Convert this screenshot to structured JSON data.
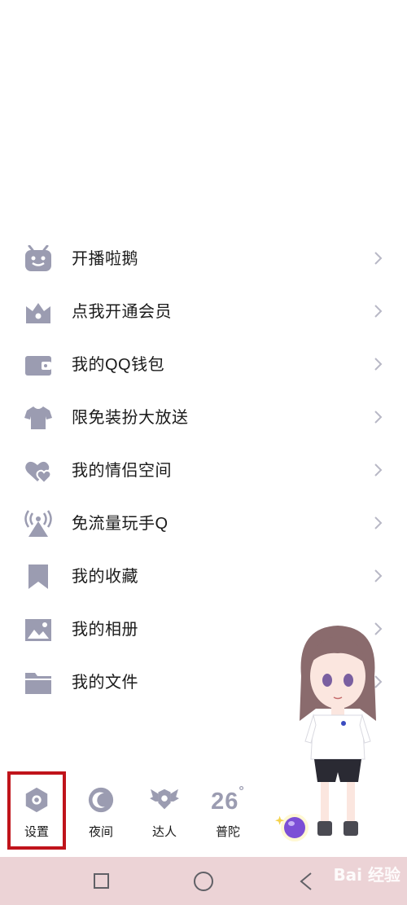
{
  "menu": {
    "items": [
      {
        "label": "开播啦鹅",
        "icon": "robot-tv-icon"
      },
      {
        "label": "点我开通会员",
        "icon": "crown-icon"
      },
      {
        "label": "我的QQ钱包",
        "icon": "wallet-icon"
      },
      {
        "label": "限免装扮大放送",
        "icon": "tshirt-icon"
      },
      {
        "label": "我的情侣空间",
        "icon": "couple-heart-icon"
      },
      {
        "label": "免流量玩手Q",
        "icon": "signal-tower-icon"
      },
      {
        "label": "我的收藏",
        "icon": "bookmark-icon"
      },
      {
        "label": "我的相册",
        "icon": "photo-icon"
      },
      {
        "label": "我的文件",
        "icon": "folder-icon"
      }
    ]
  },
  "toolbar": {
    "settings_label": "设置",
    "night_label": "夜间",
    "expert_label": "达人",
    "weather_temp": "26",
    "weather_degree": "°",
    "weather_city": "普陀"
  },
  "watermark": "Bai 经验",
  "colors": {
    "icon": "#9b9cb1",
    "highlight": "#c0141b",
    "navbar": "#ecd3d6"
  }
}
